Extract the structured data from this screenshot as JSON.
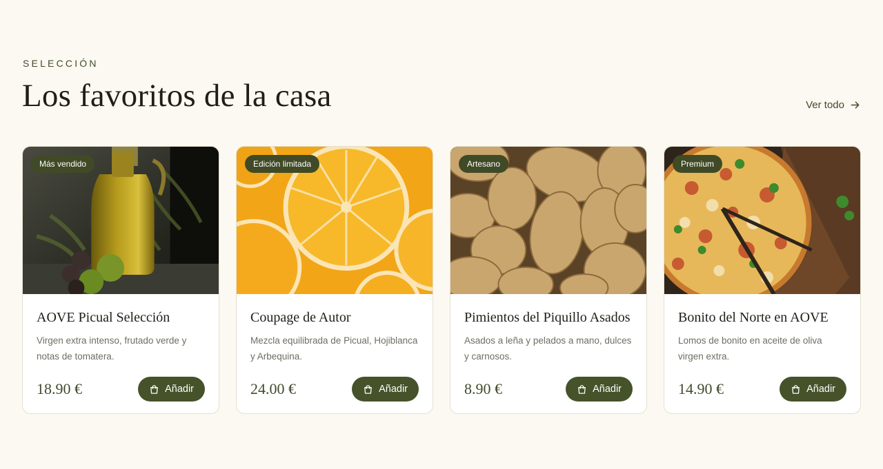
{
  "header": {
    "eyebrow": "SELECCIÓN",
    "title": "Los favoritos de la casa",
    "view_all": "Ver todo"
  },
  "products": [
    {
      "badge": "Más vendido",
      "name": "AOVE Picual Selección",
      "description": "Virgen extra intenso, frutado verde y notas de tomatera.",
      "price": "18.90 €",
      "add_label": "Añadir",
      "image": "olive-oil-bottle"
    },
    {
      "badge": "Edición limitada",
      "name": "Coupage de Autor",
      "description": "Mezcla equilibrada de Picual, Hojiblanca y Arbequina.",
      "price": "24.00 €",
      "add_label": "Añadir",
      "image": "orange-slices"
    },
    {
      "badge": "Artesano",
      "name": "Pimientos del Piquillo Asados",
      "description": "Asados a leña y pelados a mano, dulces y carnosos.",
      "price": "8.90 €",
      "add_label": "Añadir",
      "image": "potatoes"
    },
    {
      "badge": "Premium",
      "name": "Bonito del Norte en AOVE",
      "description": "Lomos de bonito en aceite de oliva virgen extra.",
      "price": "14.90 €",
      "add_label": "Añadir",
      "image": "pizza"
    }
  ],
  "colors": {
    "background": "#fcf9f2",
    "accent": "#45522a",
    "badge": "#404a26",
    "text": "#1f1f18"
  },
  "icons": {
    "view_all": "arrow-right-icon",
    "add": "shopping-bag-icon"
  }
}
